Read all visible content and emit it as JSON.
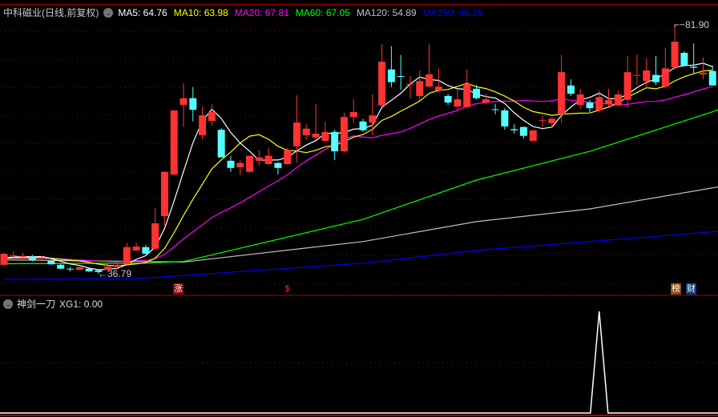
{
  "header": {
    "title": "中科磁业(日线,前复权)",
    "ma_labels": [
      {
        "text": "MA5: 64.76",
        "color": "#ffffff"
      },
      {
        "text": "MA10: 63.98",
        "color": "#ffff00"
      },
      {
        "text": "MA20: 67.81",
        "color": "#ff00ff"
      },
      {
        "text": "MA60: 67.05",
        "color": "#00ff00"
      },
      {
        "text": "MA120: 54.89",
        "color": "#c0c0c0"
      },
      {
        "text": "MA250: 46.28",
        "color": "#0000ff"
      }
    ]
  },
  "price_labels": {
    "high": "81.90",
    "low": "36.79"
  },
  "markers": [
    {
      "text": "涨",
      "bg": "#8b0000",
      "color": "#ffffff"
    },
    {
      "text": "$",
      "bg": "transparent",
      "color": "#ff2020"
    },
    {
      "text": "榜",
      "bg": "#8b4a10",
      "color": "#ffffff"
    },
    {
      "text": "财",
      "bg": "#0a3a7a",
      "color": "#ffffff"
    }
  ],
  "indicator": {
    "name": "神剑一刀",
    "label": "XG1: 0.00",
    "signal_index": 63,
    "signal_value": 1
  },
  "colors": {
    "up": "#ff3333",
    "down": "#54ffff",
    "grid": "#8b0000"
  },
  "chart_data": {
    "type": "candlestick",
    "price_range": [
      36.79,
      81.9
    ],
    "candles_ohlc": [
      [
        38.4,
        40.6,
        38.3,
        40.4
      ],
      [
        40.0,
        40.9,
        39.6,
        40.1
      ],
      [
        39.9,
        40.6,
        39.2,
        40.0
      ],
      [
        39.8,
        40.2,
        39.0,
        39.3
      ],
      [
        39.5,
        40.0,
        39.1,
        39.7
      ],
      [
        39.1,
        39.3,
        38.4,
        38.5
      ],
      [
        38.4,
        38.6,
        37.6,
        37.7
      ],
      [
        37.7,
        38.0,
        37.2,
        37.6
      ],
      [
        37.5,
        38.1,
        37.4,
        38.0
      ],
      [
        37.7,
        37.8,
        37.1,
        37.2
      ],
      [
        37.4,
        37.5,
        36.79,
        37.1
      ],
      [
        37.5,
        38.3,
        37.3,
        38.1
      ],
      [
        38.0,
        38.6,
        37.8,
        38.4
      ],
      [
        38.5,
        42.4,
        38.4,
        41.6
      ],
      [
        41.0,
        42.4,
        40.9,
        41.7
      ],
      [
        41.6,
        42.0,
        40.3,
        40.4
      ],
      [
        41.3,
        48.6,
        41.2,
        45.9
      ],
      [
        47.2,
        55.2,
        45.5,
        55.2
      ],
      [
        54.7,
        66.3,
        54.5,
        66.3
      ],
      [
        67.3,
        71.2,
        63.3,
        68.5
      ],
      [
        68.5,
        70.5,
        64.3,
        66.4
      ],
      [
        61.8,
        67.0,
        61.1,
        65.4
      ],
      [
        64.4,
        67.4,
        63.5,
        66.0
      ],
      [
        62.8,
        63.1,
        57.8,
        57.8
      ],
      [
        57.2,
        58.1,
        55.2,
        55.9
      ],
      [
        56.0,
        57.3,
        54.6,
        56.8
      ],
      [
        55.2,
        58.1,
        55.0,
        58.1
      ],
      [
        57.2,
        59.1,
        56.3,
        57.8
      ],
      [
        56.6,
        59.6,
        56.4,
        58.1
      ],
      [
        56.8,
        56.9,
        54.7,
        55.9
      ],
      [
        56.6,
        59.5,
        56.5,
        59.1
      ],
      [
        59.8,
        69.0,
        56.9,
        64.1
      ],
      [
        61.8,
        63.8,
        61.0,
        63.0
      ],
      [
        61.4,
        67.5,
        61.0,
        62.1
      ],
      [
        60.8,
        64.3,
        60.5,
        62.4
      ],
      [
        62.4,
        62.8,
        57.3,
        58.9
      ],
      [
        58.9,
        65.9,
        58.7,
        65.1
      ],
      [
        65.1,
        68.3,
        64.0,
        66.0
      ],
      [
        64.3,
        64.8,
        62.4,
        62.7
      ],
      [
        64.1,
        69.2,
        61.8,
        65.4
      ],
      [
        67.2,
        78.3,
        66.9,
        75.1
      ],
      [
        73.7,
        77.9,
        70.5,
        71.4
      ],
      [
        72.5,
        76.3,
        70.0,
        72.4
      ],
      [
        71.0,
        72.5,
        68.5,
        71.1
      ],
      [
        68.9,
        73.5,
        68.0,
        71.6
      ],
      [
        70.6,
        78.3,
        70.4,
        72.8
      ],
      [
        69.9,
        73.9,
        69.6,
        70.6
      ],
      [
        68.9,
        69.3,
        67.3,
        67.7
      ],
      [
        67.0,
        70.2,
        66.3,
        68.3
      ],
      [
        66.9,
        73.7,
        66.6,
        71.1
      ],
      [
        70.2,
        70.9,
        68.3,
        68.5
      ],
      [
        67.7,
        69.3,
        67.4,
        68.3
      ],
      [
        66.5,
        67.5,
        65.6,
        66.4
      ],
      [
        66.3,
        66.7,
        62.8,
        63.4
      ],
      [
        62.9,
        63.8,
        62.1,
        62.7
      ],
      [
        63.3,
        63.4,
        61.2,
        61.7
      ],
      [
        60.8,
        62.7,
        60.8,
        62.7
      ],
      [
        64.4,
        65.3,
        63.3,
        64.5
      ],
      [
        64.0,
        65.1,
        63.1,
        64.8
      ],
      [
        65.6,
        76.3,
        64.1,
        73.2
      ],
      [
        70.8,
        71.9,
        68.9,
        69.3
      ],
      [
        67.3,
        70.2,
        66.6,
        69.2
      ],
      [
        67.7,
        68.2,
        66.0,
        66.7
      ],
      [
        66.3,
        69.9,
        65.9,
        68.7
      ],
      [
        67.4,
        70.2,
        67.0,
        68.2
      ],
      [
        67.3,
        69.9,
        67.1,
        69.2
      ],
      [
        68.2,
        76.1,
        66.7,
        73.2
      ],
      [
        72.6,
        76.4,
        70.9,
        72.7
      ],
      [
        71.6,
        75.7,
        70.3,
        73.5
      ],
      [
        72.7,
        76.1,
        70.9,
        71.4
      ],
      [
        70.6,
        77.6,
        70.3,
        73.9
      ],
      [
        74.1,
        81.9,
        73.7,
        78.7
      ],
      [
        76.7,
        77.0,
        74.3,
        74.4
      ],
      [
        74.2,
        78.4,
        72.9,
        74.0
      ],
      [
        72.8,
        75.9,
        71.9,
        73.1
      ],
      [
        73.4,
        74.4,
        70.8,
        70.8
      ]
    ],
    "ma_long": {
      "MA60": [
        [
          0,
          38.6
        ],
        [
          15,
          38.7
        ],
        [
          19,
          39.0
        ],
        [
          38,
          46.6
        ],
        [
          50,
          53.7
        ],
        [
          62,
          58.9
        ],
        [
          76,
          66.6
        ]
      ],
      "MA120": [
        [
          0,
          39.3
        ],
        [
          19,
          38.9
        ],
        [
          38,
          42.6
        ],
        [
          50,
          46.2
        ],
        [
          62,
          48.5
        ],
        [
          76,
          52.6
        ]
      ],
      "MA250": [
        [
          0,
          35.8
        ],
        [
          14,
          35.9
        ],
        [
          38,
          38.7
        ],
        [
          50,
          41.0
        ],
        [
          76,
          44.5
        ]
      ]
    },
    "pre_history_close": 39.5
  }
}
